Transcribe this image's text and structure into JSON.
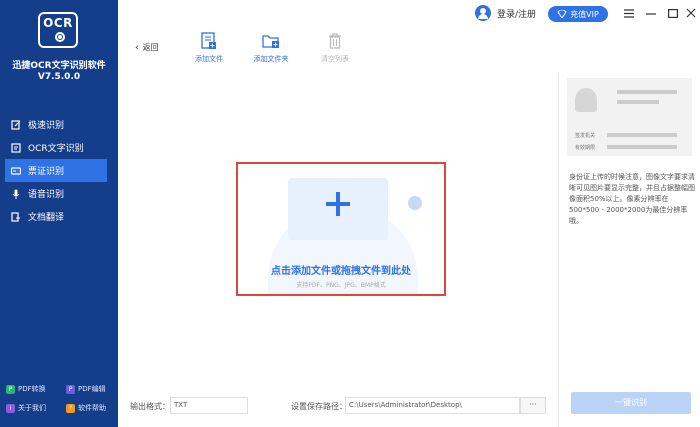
{
  "app": {
    "logo": "OCR",
    "name": "迅捷OCR文字识别软件",
    "version": "V7.5.0.0"
  },
  "nav": [
    {
      "label": "极速识别",
      "icon": "edit-icon"
    },
    {
      "label": "OCR文字识别",
      "icon": "document-icon"
    },
    {
      "label": "票证识别",
      "icon": "card-icon",
      "active": true
    },
    {
      "label": "语音识别",
      "icon": "microphone-icon"
    },
    {
      "label": "文档翻译",
      "icon": "translate-icon"
    }
  ],
  "bottom_links": {
    "pdf_convert": "PDF转换",
    "pdf_edit": "PDF编辑",
    "about": "关于我们",
    "help": "软件帮助"
  },
  "header": {
    "login": "登录/注册",
    "vip": "充值VIP"
  },
  "toolbar": {
    "back": "返回",
    "add_file": "添加文件",
    "add_folder": "添加文件夹",
    "clear_list": "清空列表"
  },
  "dropzone": {
    "title": "点击添加文件或拖拽文件到此处",
    "subtitle": "支持PDF、PNG、JPG、BMP格式"
  },
  "footer": {
    "format_label": "输出格式：",
    "format_value": "TXT",
    "path_label": "设置保存路径：",
    "path_value": "C:\\Users\\Administrator\\Desktop\\",
    "browse": "···"
  },
  "right_panel": {
    "id_label_1": "签发机关",
    "id_label_2": "有效期限",
    "tip": "身份证上传的时候注意，图像文字要求清晰可见图片要显示完整，并且占据整幅图像面积50%以上。像素分辨率在500*500 - 2000*2000为最佳分辨率哦。",
    "button": "一键识别"
  },
  "colors": {
    "sidebar": "#143e8a",
    "accent": "#2e72e6",
    "highlight": "#e3443b"
  }
}
